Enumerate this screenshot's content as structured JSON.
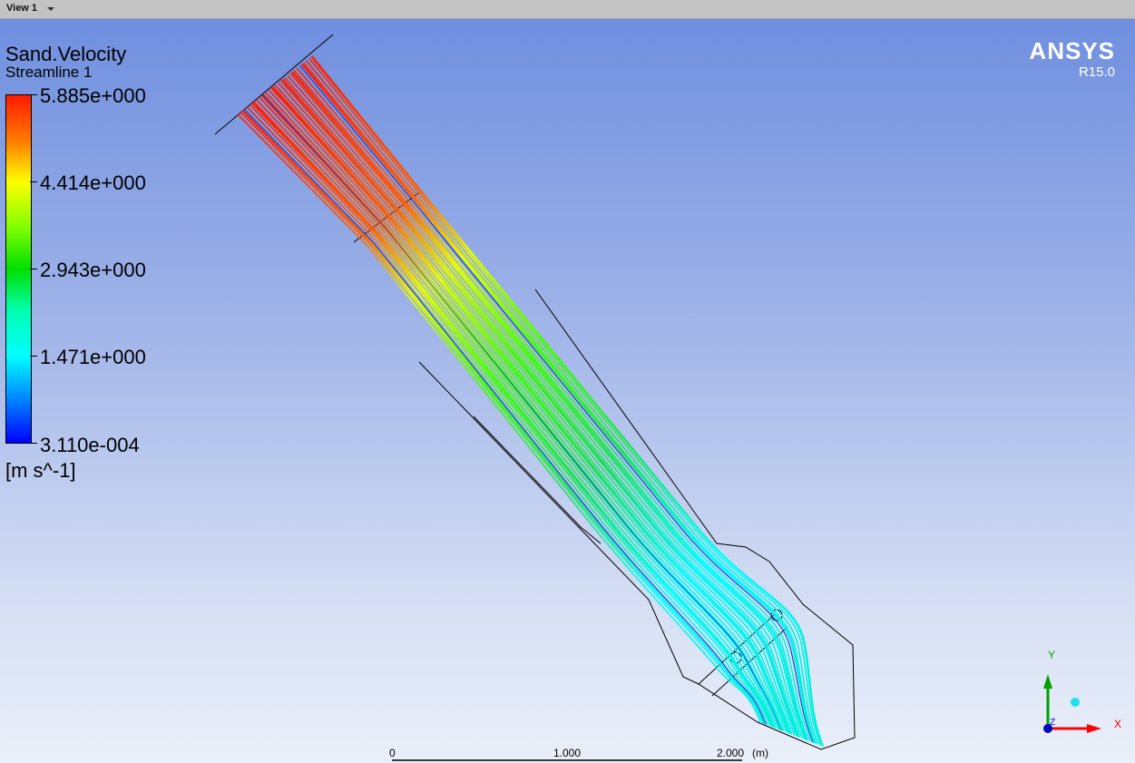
{
  "tab": {
    "label": "View 1"
  },
  "legend": {
    "variable": "Sand.Velocity",
    "object": "Streamline 1",
    "labels": [
      "5.885e+000",
      "4.414e+000",
      "2.943e+000",
      "1.471e+000",
      "3.110e-004"
    ],
    "units": "[m s^-1]",
    "range": [
      0.000311,
      5.885
    ]
  },
  "brand": {
    "name": "ANSYS",
    "version": "R15.0"
  },
  "scale": {
    "labels": [
      "0",
      "1.000",
      "2.000"
    ],
    "unit": "(m)"
  },
  "axes": {
    "x": "X",
    "y": "Y",
    "z": "Z",
    "colors": {
      "x": "#ff0000",
      "y": "#00a000",
      "z": "#0000ff"
    }
  }
}
